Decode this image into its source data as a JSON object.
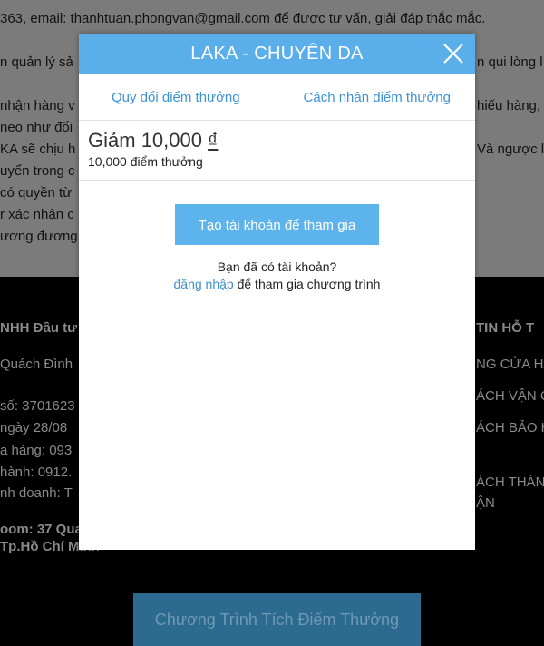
{
  "background": {
    "lines": [
      "363, email: thanhtuan.phongvan@gmail.com để được tư vấn,  giải đáp thắc mắc.",
      "n quản lý sả",
      "nhận hàng v",
      "neo như đổi",
      "KA sẽ chịu h",
      "uyển trong c",
      "có quyền từ",
      "r xác nhận c",
      "ương đương"
    ],
    "right_fragments": [
      "n qui lòng l",
      "hiếu hàng,",
      "Và ngược lạ"
    ],
    "footer_left": [
      "NHH Đầu tư",
      "Quách Đình",
      "số: 3701623",
      "ngày 28/08",
      "a hàng: 093",
      "hành: 0912.",
      "nh doanh: T"
    ],
    "footer_left_bold": [
      "oom: 37 Qua",
      "Tp.Hồ Chí Minh"
    ],
    "footer_right": [
      "TIN HỖ T",
      "NG CỬA HÀ",
      "ÁCH VẬN C",
      "ÁCH BẢO H",
      "ÁCH THÁN",
      "ẬN"
    ],
    "banner_label": "Chương Trình Tích Điểm Thưởng"
  },
  "modal": {
    "title": "LAKA - CHUYÊN DA",
    "tabs": [
      "Quy đổi điểm thưởng",
      "Cách nhận điểm thưởng"
    ],
    "reward": {
      "prefix": "Giảm",
      "amount": "10,000",
      "currency": "₫",
      "points": "10,000 điểm thưởng"
    },
    "cta_label": "Tạo tài khoản để tham gia",
    "account_question": "Bạn đã có tài khoản?",
    "login_link": "đăng nhập",
    "login_suffix": " để tham gia chương trình"
  },
  "colors": {
    "header": "#5aaee9",
    "link": "#3d93d8",
    "cta": "#5db3ec",
    "overlay_top": "#7b7b7b",
    "banner": "#2d6a90"
  },
  "icons": {
    "close": "close-icon"
  }
}
